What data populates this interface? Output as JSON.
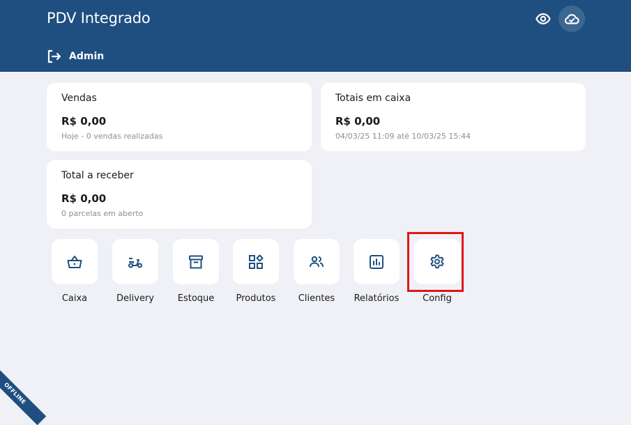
{
  "header": {
    "title": "PDV Integrado",
    "user": "Admin",
    "icons": {
      "visibility": "eye-icon",
      "sync": "cloud-sync-icon",
      "logout": "logout-icon"
    },
    "color": "#1f4f80"
  },
  "cards": [
    {
      "title": "Vendas",
      "value": "R$ 0,00",
      "sub": "Hoje - 0 vendas realizadas"
    },
    {
      "title": "Totais em caixa",
      "value": "R$ 0,00",
      "sub": "04/03/25 11:09 até 10/03/25 15:44"
    },
    {
      "title": "Total a receber",
      "value": "R$ 0,00",
      "sub": "0 parcelas em aberto"
    }
  ],
  "menu": [
    {
      "label": "Caixa",
      "icon": "basket-icon"
    },
    {
      "label": "Delivery",
      "icon": "scooter-icon"
    },
    {
      "label": "Estoque",
      "icon": "archive-icon"
    },
    {
      "label": "Produtos",
      "icon": "grid-icon"
    },
    {
      "label": "Clientes",
      "icon": "users-icon"
    },
    {
      "label": "Relatórios",
      "icon": "report-icon"
    },
    {
      "label": "Config",
      "icon": "gear-icon"
    }
  ],
  "offline_badge": "OFFLINE",
  "highlight_color": "#e01717"
}
